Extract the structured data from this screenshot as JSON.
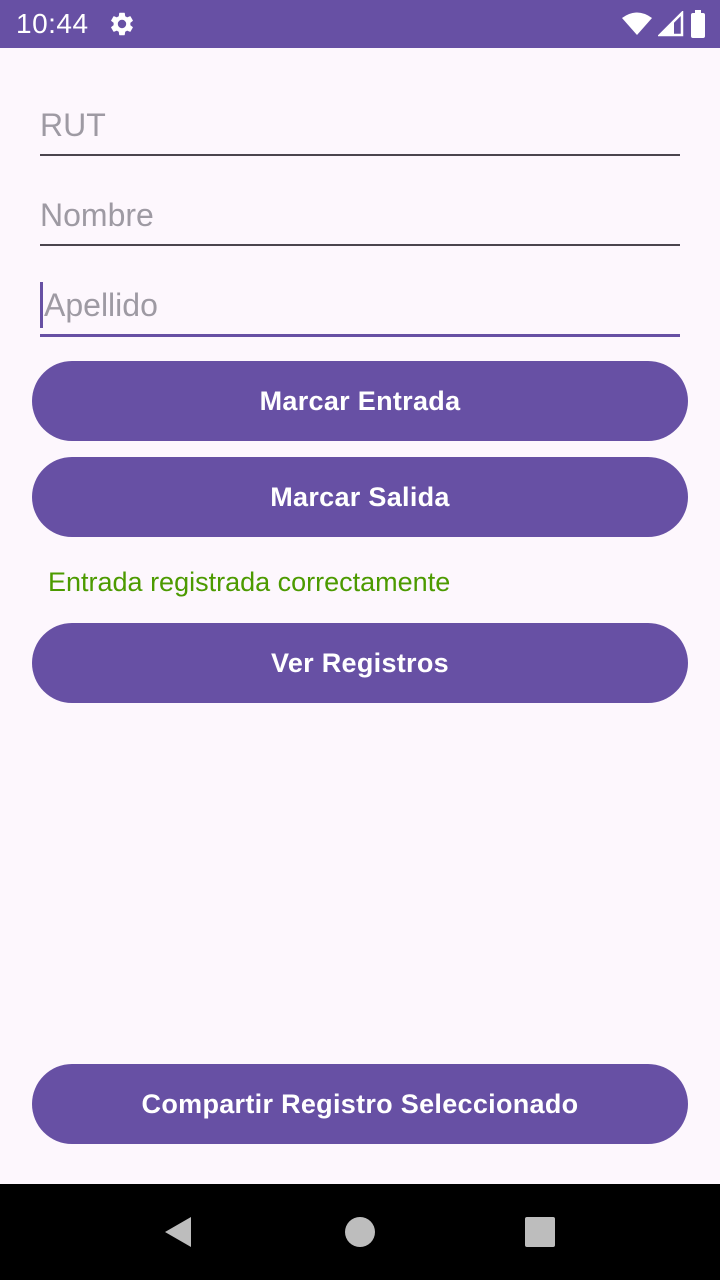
{
  "status_bar": {
    "time": "10:44",
    "background": "#6750a4",
    "icons": [
      "gear-icon",
      "wifi-icon",
      "signal-icon",
      "battery-icon"
    ]
  },
  "form": {
    "rut_placeholder": "RUT",
    "rut_value": "",
    "nombre_placeholder": "Nombre",
    "nombre_value": "",
    "apellido_placeholder": "Apellido",
    "apellido_value": ""
  },
  "buttons": {
    "marcar_entrada": "Marcar Entrada",
    "marcar_salida": "Marcar Salida",
    "ver_registros": "Ver Registros",
    "compartir": "Compartir Registro Seleccionado"
  },
  "message": {
    "text": "Entrada registrada correctamente",
    "color": "#4c9a00"
  },
  "colors": {
    "accent": "#6750a4",
    "background": "#fdf7fd"
  },
  "nav_bar": {
    "icons": [
      "back-icon",
      "home-icon",
      "recents-icon"
    ]
  }
}
